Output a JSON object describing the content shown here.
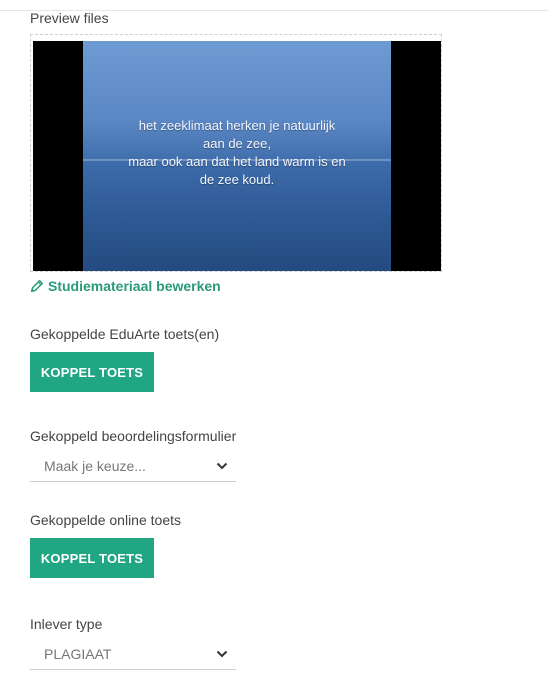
{
  "preview": {
    "label": "Preview files",
    "caption": "het zeeklimaat herken je natuurlijk\naan de zee,\nmaar ook aan dat het land warm is en\nde zee koud."
  },
  "edit_link": {
    "label": "Studiemateriaal bewerken"
  },
  "eduarte": {
    "label": "Gekoppelde EduArte toets(en)",
    "button": "KOPPEL TOETS"
  },
  "assessment_form": {
    "label": "Gekoppeld beoordelingsformulier",
    "selected": "Maak je keuze..."
  },
  "online_test": {
    "label": "Gekoppelde online toets",
    "button": "KOPPEL TOETS"
  },
  "submit_type": {
    "label": "Inlever type",
    "selected": "PLAGIAAT"
  },
  "colors": {
    "accent": "#21a683",
    "link": "#2a9a7a"
  }
}
